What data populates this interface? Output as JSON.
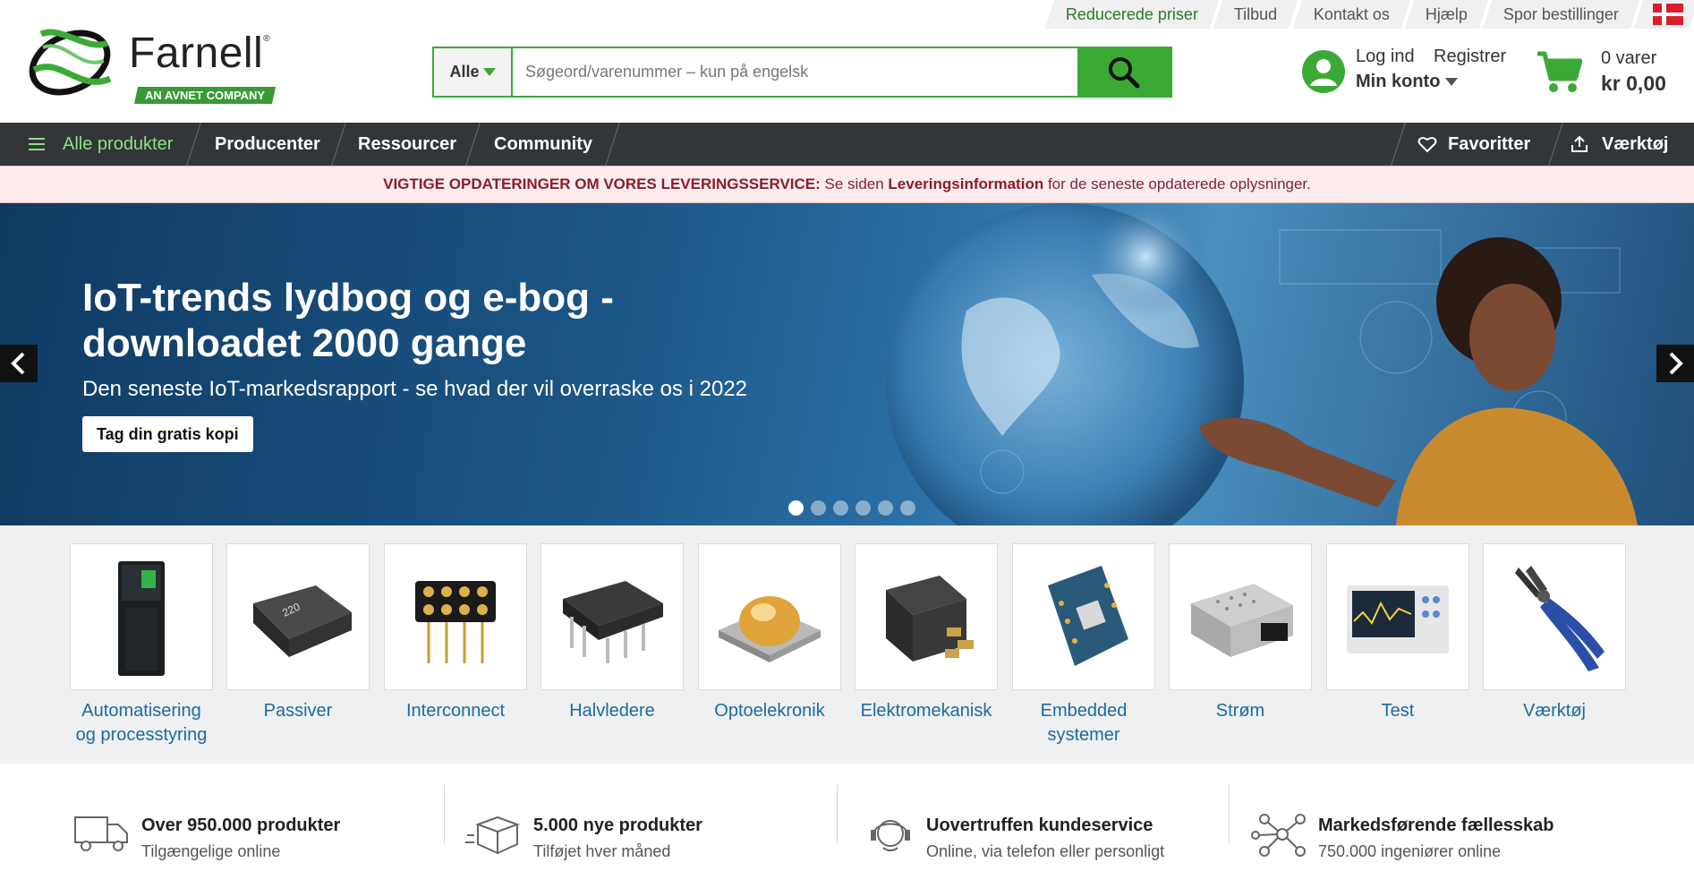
{
  "brand": {
    "name": "Farnell",
    "tagline": "AN AVNET COMPANY",
    "accent": "#3aaa35"
  },
  "toplinks": [
    "Reducerede priser",
    "Tilbud",
    "Kontakt os",
    "Hjælp",
    "Spor bestillinger"
  ],
  "search": {
    "category": "Alle",
    "placeholder": "Søgeord/varenummer – kun på engelsk"
  },
  "account": {
    "login": "Log ind",
    "register": "Registrer",
    "my_account": "Min konto"
  },
  "cart": {
    "count": "0 varer",
    "total": "kr 0,00"
  },
  "nav": {
    "all": "Alle produkter",
    "items": [
      "Producenter",
      "Ressourcer",
      "Community"
    ],
    "favorites": "Favoritter",
    "tools": "Værktøj"
  },
  "alert": {
    "bold_prefix": "VIGTIGE OPDATERINGER OM VORES LEVERINGSSERVICE:",
    "text1": " Se siden ",
    "link": "Leveringsinformation",
    "text2": " for de seneste opdaterede oplysninger."
  },
  "hero": {
    "title": "IoT-trends lydbog og e-bog - downloadet 2000 gange",
    "subtitle": "Den seneste IoT-markedsrapport - se hvad der vil overraske os i 2022",
    "button": "Tag din gratis kopi",
    "slides": 6,
    "active_slide": 1
  },
  "categories": [
    "Automatisering og processtyring",
    "Passiver",
    "Interconnect",
    "Halvledere",
    "Optoelekronik",
    "Elektromekanisk",
    "Embedded systemer",
    "Strøm",
    "Test",
    "Værktøj"
  ],
  "usps": [
    {
      "icon": "truck-icon",
      "title": "Over 950.000 produkter",
      "subtitle": "Tilgængelige online"
    },
    {
      "icon": "box-icon",
      "title": "5.000 nye produkter",
      "subtitle": "Tilføjet hver måned"
    },
    {
      "icon": "headset-icon",
      "title": "Uovertruffen kundeservice",
      "subtitle": "Online, via telefon eller personligt"
    },
    {
      "icon": "network-icon",
      "title": "Markedsførende fællesskab",
      "subtitle": "750.000 ingeniører online"
    }
  ]
}
